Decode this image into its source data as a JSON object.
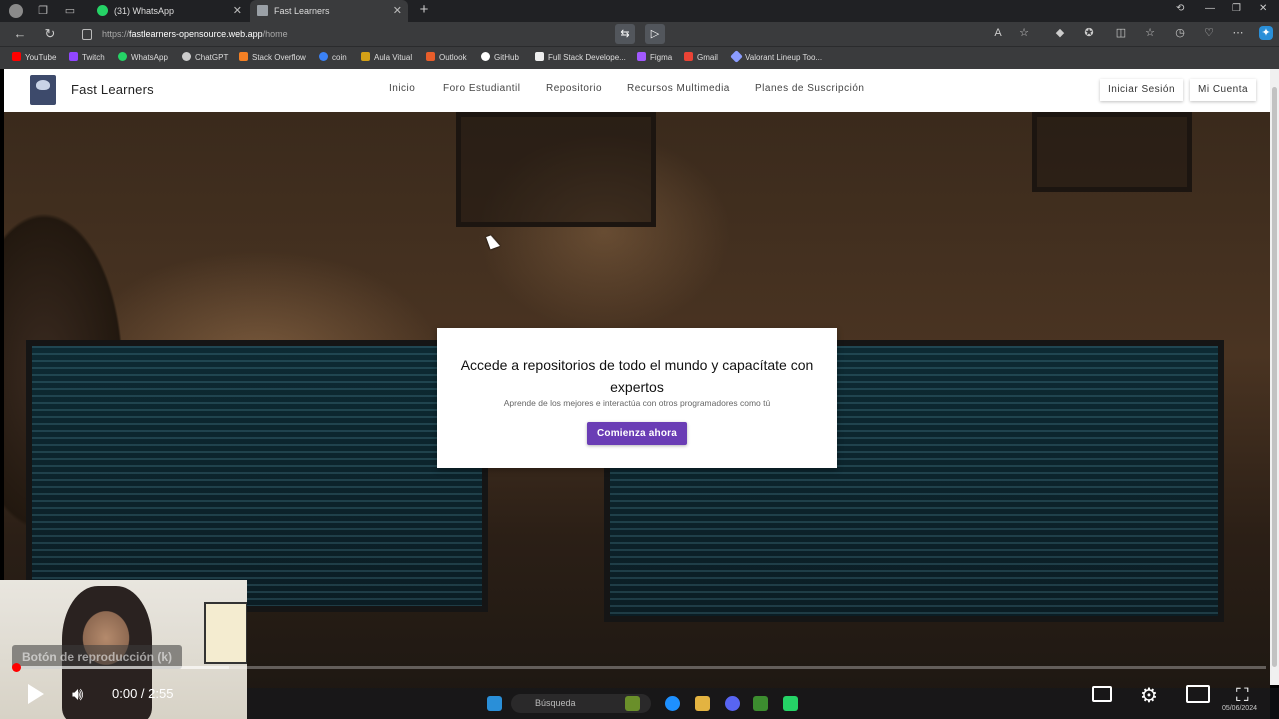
{
  "browser": {
    "tabs": [
      {
        "title": "(31) WhatsApp",
        "favicon_color": "#25D366"
      },
      {
        "title": "Fast Learners",
        "favicon_color": "#9aa0a6"
      }
    ],
    "url_scheme": "https://",
    "url_host": "fastlearners-opensource.web.app",
    "url_path": "/home"
  },
  "bookmarks": [
    {
      "label": "YouTube",
      "color": "#ff0000"
    },
    {
      "label": "Twitch",
      "color": "#9146ff"
    },
    {
      "label": "WhatsApp",
      "color": "#25D366"
    },
    {
      "label": "ChatGPT",
      "color": "#cccccc"
    },
    {
      "label": "Stack Overflow",
      "color": "#f48024"
    },
    {
      "label": "coin",
      "color": "#3b82f6"
    },
    {
      "label": "Aula Vitual",
      "color": "#d4a017"
    },
    {
      "label": "Outlook",
      "color": "#e85d2a"
    },
    {
      "label": "GitHub",
      "color": "#ffffff"
    },
    {
      "label": "Full Stack Develope...",
      "color": "#eeeeee"
    },
    {
      "label": "Figma",
      "color": "#a259ff"
    },
    {
      "label": "Gmail",
      "color": "#ea4335"
    },
    {
      "label": "Valorant Lineup Too...",
      "color": "#8b9cff"
    }
  ],
  "site": {
    "brand": "Fast Learners",
    "nav": [
      "Inicio",
      "Foro Estudiantil",
      "Repositorio",
      "Recursos Multimedia",
      "Planes de Suscripción"
    ],
    "login": "Iniciar Sesión",
    "account": "Mi Cuenta"
  },
  "hero": {
    "title": "Accede a repositorios de todo el mundo y capacítate con expertos",
    "subtitle": "Aprende de los mejores e interactúa con otros programadores como tú",
    "cta": "Comienza ahora",
    "cta_color": "#6a3db5"
  },
  "player": {
    "tooltip": "Botón de reproducción (k)",
    "time": "0:00 / 2:55",
    "progress_fraction": 0.0
  },
  "taskbar": {
    "search": "Búsqueda",
    "date": "05/06/2024"
  }
}
